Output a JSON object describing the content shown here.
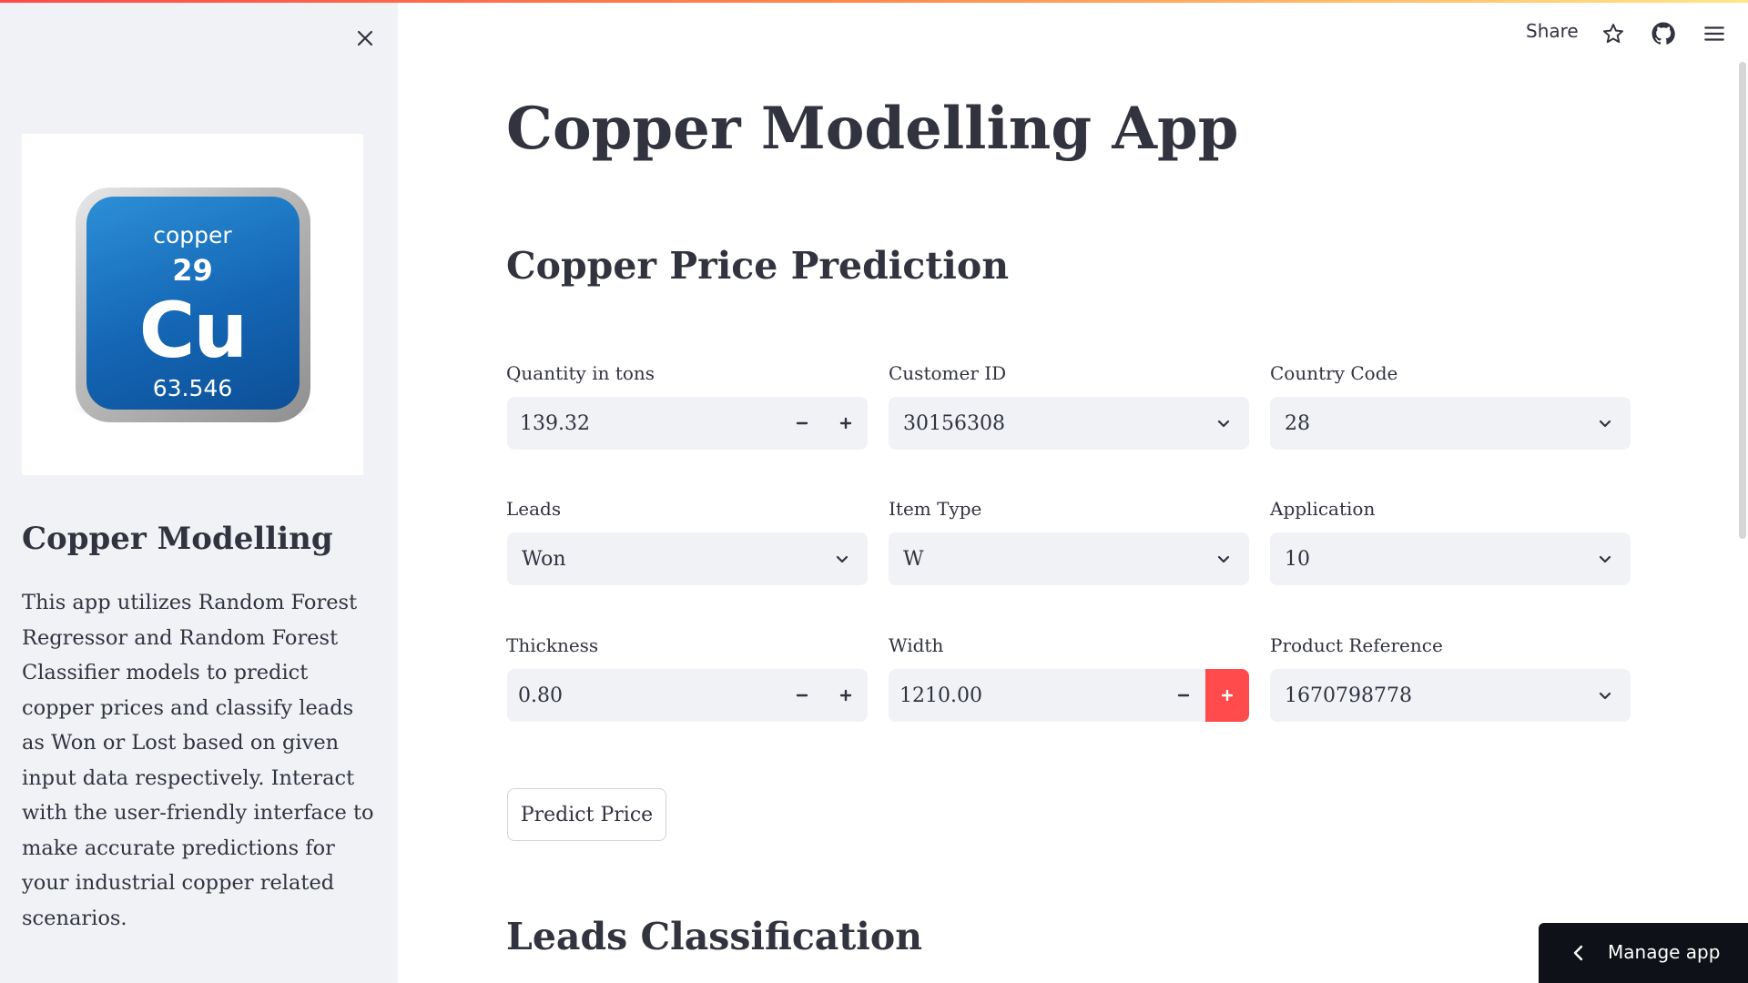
{
  "sidebar": {
    "close_icon": "close-icon",
    "logo": {
      "name": "copper",
      "number": "29",
      "symbol": "Cu",
      "mass": "63.546",
      "tile_color": "#1466b4"
    },
    "heading": "Copper Modelling",
    "description": "This app utilizes Random Forest Regressor and Random Forest Classifier models to predict copper prices and classify leads as Won or Lost based on given input data respectively. Interact with the user-friendly interface to make accurate predictions for your industrial copper related scenarios."
  },
  "header": {
    "share_label": "Share",
    "icons": [
      "star-icon",
      "github-icon",
      "hamburger-menu-icon"
    ]
  },
  "main": {
    "title": "Copper Modelling App",
    "price_section_title": "Copper Price Prediction",
    "fields": {
      "quantity": {
        "label": "Quantity in tons",
        "value": "139.32"
      },
      "customer": {
        "label": "Customer ID",
        "value": "30156308"
      },
      "country": {
        "label": "Country Code",
        "value": "28"
      },
      "leads": {
        "label": "Leads",
        "value": "Won"
      },
      "item_type": {
        "label": "Item Type",
        "value": "W"
      },
      "application": {
        "label": "Application",
        "value": "10"
      },
      "thickness": {
        "label": "Thickness",
        "value": "0.80"
      },
      "width": {
        "label": "Width",
        "value": "1210.00"
      },
      "product_ref": {
        "label": "Product Reference",
        "value": "1670798778"
      }
    },
    "predict_button": "Predict Price",
    "classification_section_title": "Leads Classification"
  },
  "manage_app": {
    "label": "Manage app"
  },
  "colors": {
    "accent": "#ff4b4b",
    "input_bg": "#f0f2f6",
    "sidebar_bg": "#f0f2f6",
    "text": "#31333f"
  }
}
